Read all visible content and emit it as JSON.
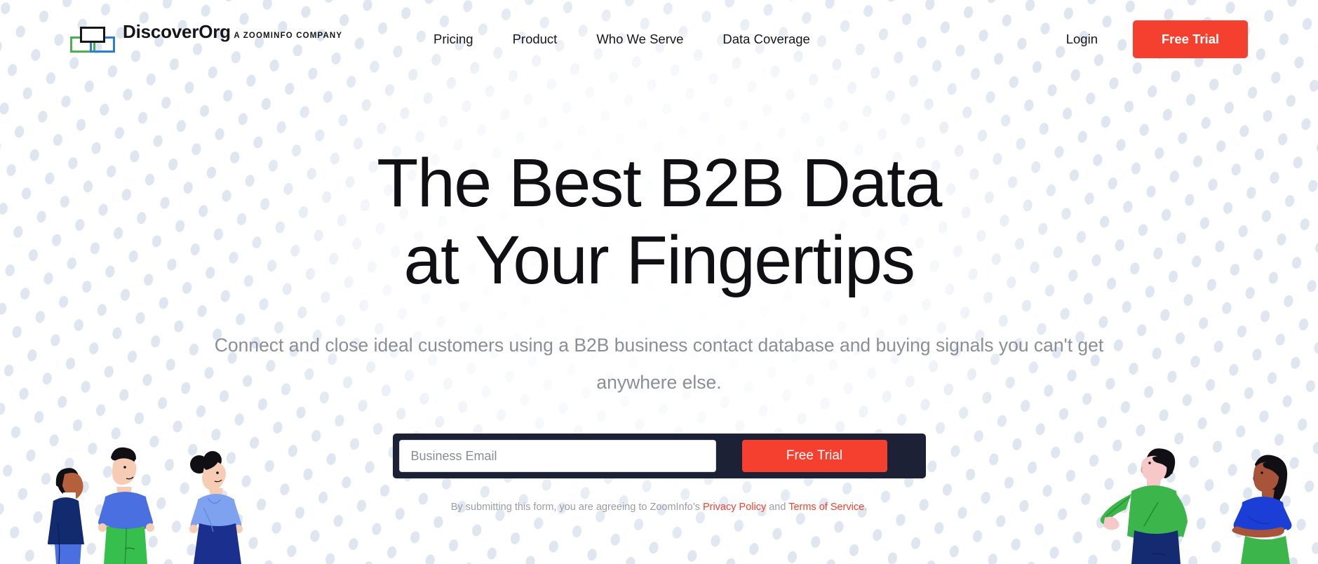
{
  "brand": {
    "name": "DiscoverOrg",
    "tagline": "A ZOOMINFO COMPANY",
    "accent_red": "#f6402f",
    "logo_green": "#4caf50",
    "logo_blue": "#2f7dd1",
    "logo_black": "#16161a",
    "form_navy": "#1c2136"
  },
  "header": {
    "nav": [
      {
        "label": "Pricing"
      },
      {
        "label": "Product"
      },
      {
        "label": "Who We Serve"
      },
      {
        "label": "Data Coverage"
      }
    ],
    "login_label": "Login",
    "cta_label": "Free Trial"
  },
  "hero": {
    "title_line1": "The Best B2B Data",
    "title_line2": "at Your Fingertips",
    "subtitle": "Connect and close ideal customers using a B2B business contact database and buying signals you can't get anywhere else."
  },
  "form": {
    "email_placeholder": "Business Email",
    "email_value": "",
    "submit_label": "Free Trial",
    "legal_prefix": "By submitting this form, you are agreeing to ZoomInfo’s ",
    "legal_privacy": "Privacy Policy",
    "legal_middle": " and ",
    "legal_terms": "Terms of Service",
    "legal_suffix": "."
  },
  "illustration": {
    "left_alt": "three people looking upward",
    "right_alt": "two people looking upward"
  }
}
